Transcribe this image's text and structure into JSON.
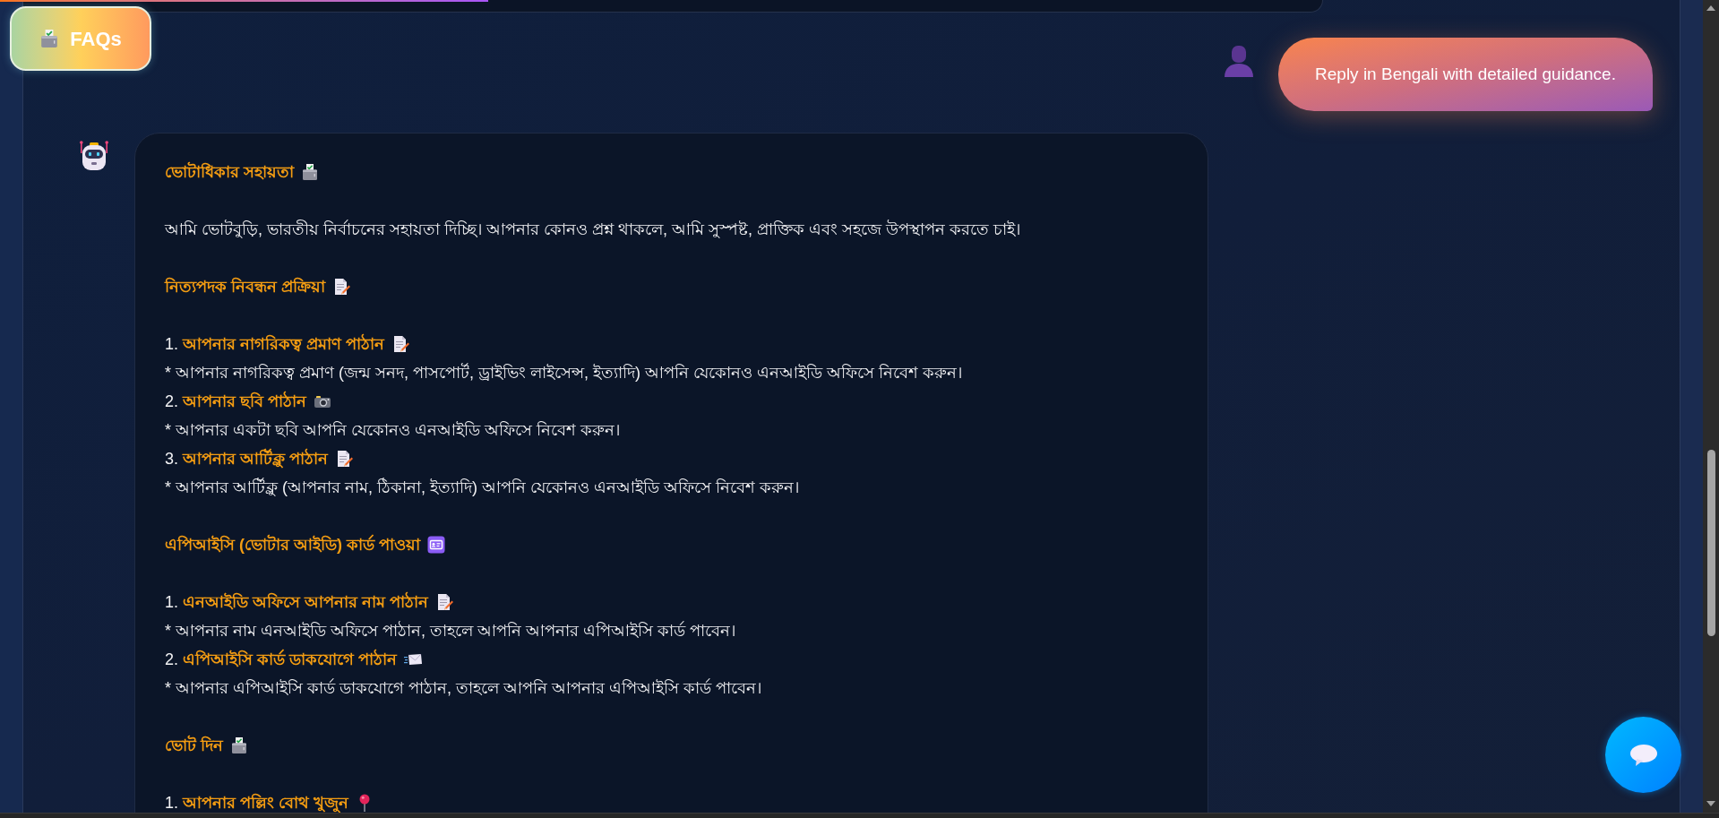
{
  "faq_button": {
    "label": "FAQs"
  },
  "user_message": {
    "text": "Reply in Bengali with detailed guidance."
  },
  "bot_message": {
    "sections": [
      {
        "heading": "ভোটাধিকার সহায়তা",
        "paragraph": "আমি ভোটবুড়ি, ভারতীয় নির্বাচনের সহায়তা দিচ্ছি। আপনার কোনও প্রশ্ন থাকলে, আমি সুস্পষ্ট, প্রাক্তিক এবং সহজে উপস্থাপন করতে চাই।"
      },
      {
        "heading": "নিত্যপদক নিবন্ধন প্রক্রিয়া",
        "steps": [
          {
            "title": "1. **আপনার নাগরিকত্ব প্রমাণ পাঠান**",
            "detail": "* আপনার নাগরিকত্ব প্রমাণ (জন্ম সনদ, পাসপোর্ট, ড্রাইভিং লাইসেন্স, ইত্যাদি) আপনি যেকোনও এনআইডি অফিসে নিবেশ করুন।"
          },
          {
            "title": "2. **আপনার ছবি পাঠান**",
            "detail": "* আপনার একটা ছবি আপনি যেকোনও এনআইডি অফিসে নিবেশ করুন।"
          },
          {
            "title": "3. **আপনার আর্টিক্লু পাঠান**",
            "detail": "* আপনার আর্টিক্লু (আপনার নাম, ঠিকানা, ইত্যাদি) আপনি যেকোনও এনআইডি অফিসে নিবেশ করুন।"
          }
        ]
      },
      {
        "heading": "এপিআইসি (ভোটার আইডি) কার্ড পাওয়া",
        "steps": [
          {
            "title": "1. **এনআইডি অফিসে আপনার নাম পাঠান**",
            "detail": "* আপনার নাম এনআইডি অফিসে পাঠান, তাহলে আপনি আপনার এপিআইসি কার্ড পাবেন।"
          },
          {
            "title": "2. **এপিআইসি কার্ড ডাকযোগে পাঠান**",
            "detail": "* আপনার এপিআইসি কার্ড ডাকযোগে পাঠান, তাহলে আপনি আপনার এপিআইসি কার্ড পাবেন।"
          }
        ]
      },
      {
        "heading": "ভোট দিন",
        "steps": [
          {
            "title": "1. **আপনার পল্লিং বোথ খুজুন**"
          }
        ]
      }
    ]
  }
}
